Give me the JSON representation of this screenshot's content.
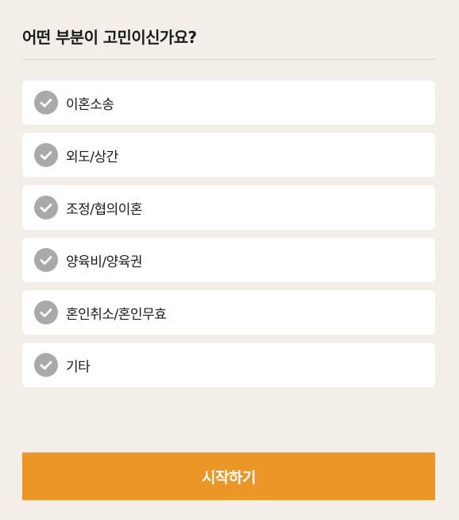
{
  "question": "어떤 부분이 고민이신가요?",
  "options": [
    {
      "label": "이혼소송",
      "icon": "check-circle-icon"
    },
    {
      "label": "외도/상간",
      "icon": "check-circle-icon"
    },
    {
      "label": "조정/협의이혼",
      "icon": "check-circle-icon"
    },
    {
      "label": "양육비/양육권",
      "icon": "check-circle-icon"
    },
    {
      "label": "혼인취소/혼인무효",
      "icon": "check-circle-icon"
    },
    {
      "label": "기타",
      "icon": "check-circle-icon"
    }
  ],
  "start_button": {
    "label": "시작하기"
  },
  "colors": {
    "background": "#f3efe8",
    "card": "#ffffff",
    "check_inactive": "#a9a9a9",
    "accent": "#ea9728"
  }
}
